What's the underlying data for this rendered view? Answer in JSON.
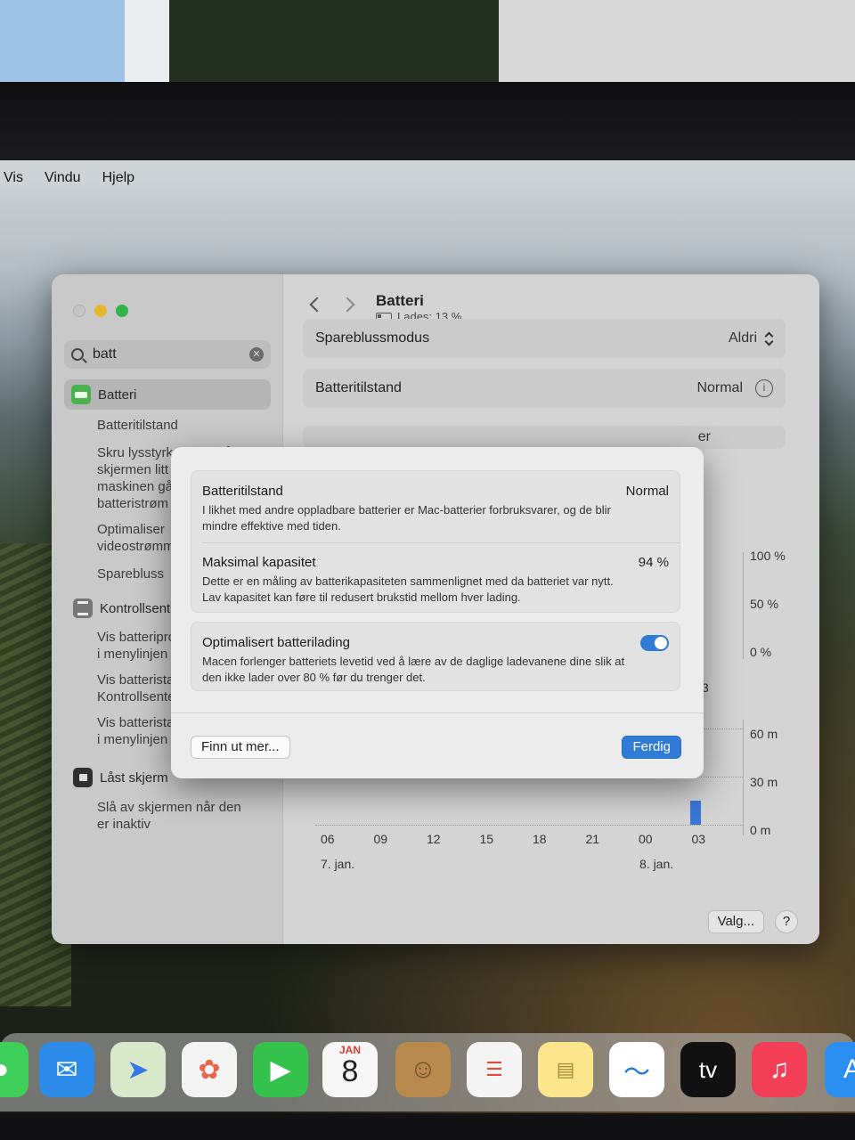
{
  "menubar": {
    "items": [
      "Vis",
      "Vindu",
      "Hjelp"
    ]
  },
  "search": {
    "value": "batt"
  },
  "sidebar": {
    "battery": "Batteri",
    "battery_subs": [
      "Batteritilstand",
      "Skru lysstyrken ned på",
      "skjermen litt når",
      "maskinen går på",
      "batteristrøm",
      "Optimaliser",
      "videostrømming",
      "Sparebluss"
    ],
    "control_center": "Kontrollsenter",
    "cc_subs": [
      "Vis batteriprosent",
      "i menylinjen",
      "Vis batteristatus i",
      "Kontrollsenter",
      "Vis batteristatus",
      "i menylinjen"
    ],
    "lock_screen": "Låst skjerm",
    "lock_subs": [
      "Slå av skjermen når den",
      "er inaktiv"
    ]
  },
  "content": {
    "title": "Batteri",
    "subtitle": "Lades: 13 %",
    "rows": {
      "low_power_label": "Spareblussmodus",
      "low_power_value": "Aldri",
      "health_label": "Batteritilstand",
      "health_value": "Normal",
      "hidden_fragment": "er"
    },
    "chart": {
      "pct_ticks": [
        "100 %",
        "50 %",
        "0 %"
      ],
      "fragment": "3",
      "min_ticks": [
        "60 m",
        "30 m",
        "0 m"
      ],
      "x_ticks": [
        "06",
        "09",
        "12",
        "15",
        "18",
        "21",
        "00",
        "03"
      ],
      "dates": [
        "7. jan.",
        "8. jan."
      ]
    },
    "options_button": "Valg...",
    "help_button": "?"
  },
  "chart_data": {
    "type": "bar",
    "title": "",
    "xlabel": "",
    "ylabel": "",
    "categories": [
      "06",
      "09",
      "12",
      "15",
      "18",
      "21",
      "00",
      "03"
    ],
    "series": [
      {
        "values": [
          0,
          0,
          0,
          0,
          0,
          0,
          0,
          15
        ]
      }
    ],
    "ylim": [
      0,
      60
    ],
    "y_ticks": [
      "60 m",
      "30 m",
      "0 m"
    ]
  },
  "modal": {
    "health_title": "Batteritilstand",
    "health_value": "Normal",
    "health_desc": "I likhet med andre oppladbare batterier er Mac-batterier forbruksvarer, og de blir mindre effektive med tiden.",
    "capacity_title": "Maksimal kapasitet",
    "capacity_value": "94 %",
    "capacity_desc": "Dette er en måling av batterikapasiteten sammenlignet med da batteriet var nytt. Lav kapasitet kan føre til redusert brukstid mellom hver lading.",
    "optimized_title": "Optimalisert batterilading",
    "optimized_desc": "Macen forlenger batteriets levetid ved å lære av de daglige ladevanene dine slik at den ikke lader over 80 % før du trenger det.",
    "learn_more": "Finn ut mer...",
    "done": "Ferdig"
  },
  "dock": {
    "calendar_month": "JAN",
    "calendar_day": "8",
    "tv_label": "tv"
  },
  "colors": {
    "accent": "#2f7bd6",
    "battery_green": "#4caf50"
  }
}
